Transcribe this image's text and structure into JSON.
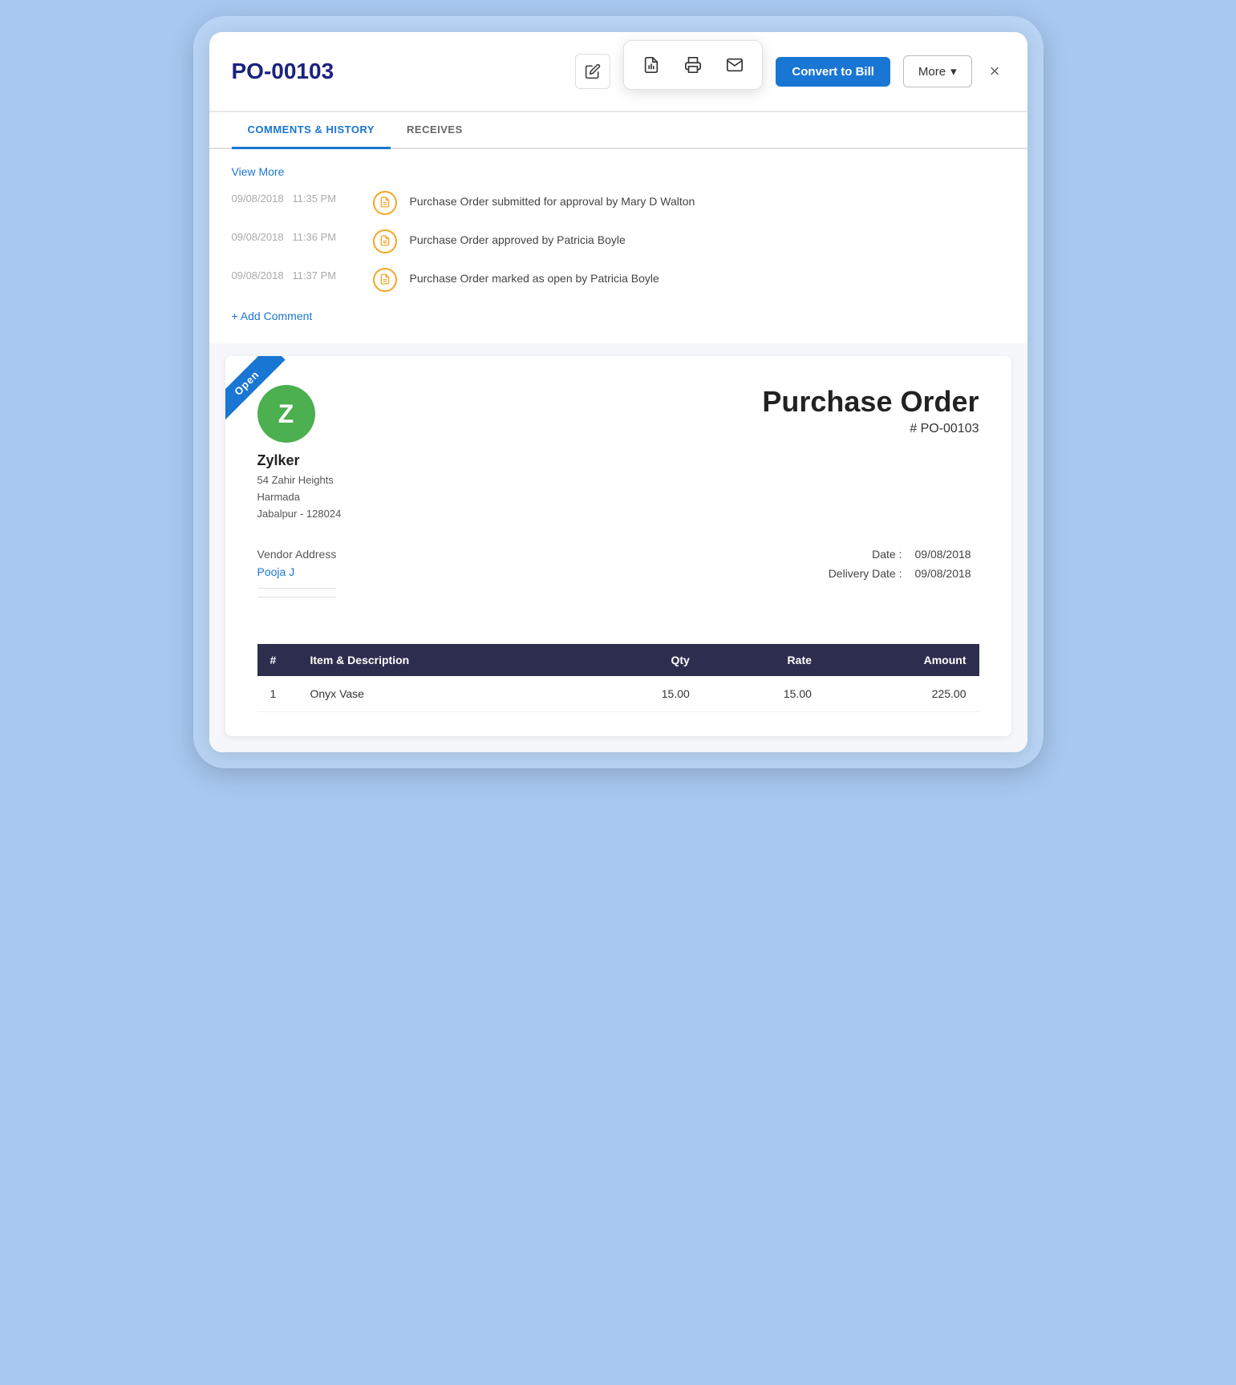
{
  "header": {
    "po_number": "PO-00103",
    "convert_btn": "Convert to Bill",
    "more_btn": "More",
    "close_icon": "×"
  },
  "toolbar": {
    "icons": [
      "edit",
      "pdf",
      "print",
      "email"
    ]
  },
  "tabs": [
    {
      "label": "COMMENTS & HISTORY",
      "active": true
    },
    {
      "label": "RECEIVES",
      "active": false
    }
  ],
  "comments": {
    "view_more": "View More",
    "history": [
      {
        "date": "09/08/2018",
        "time": "11:35 PM",
        "text": "Purchase Order submitted for approval by Mary D Walton"
      },
      {
        "date": "09/08/2018",
        "time": "11:36 PM",
        "text": "Purchase Order approved by Patricia Boyle"
      },
      {
        "date": "09/08/2018",
        "time": "11:37 PM",
        "text": "Purchase Order marked as open by Patricia Boyle"
      }
    ],
    "add_comment": "+ Add Comment"
  },
  "document": {
    "status_banner": "Open",
    "vendor_initial": "Z",
    "vendor_name": "Zylker",
    "vendor_address_line1": "54 Zahir Heights",
    "vendor_address_line2": "Harmada",
    "vendor_address_line3": "Jabalpur - 128024",
    "vendor_address_label": "Vendor Address",
    "vendor_contact": "Pooja J",
    "title": "Purchase Order",
    "po_ref": "# PO-00103",
    "date_label": "Date :",
    "date_value": "09/08/2018",
    "delivery_date_label": "Delivery Date :",
    "delivery_date_value": "09/08/2018",
    "table": {
      "columns": [
        "#",
        "Item & Description",
        "Qty",
        "Rate",
        "Amount"
      ],
      "rows": [
        {
          "num": "1",
          "item": "Onyx Vase",
          "qty": "15.00",
          "rate": "15.00",
          "amount": "225.00"
        }
      ]
    }
  }
}
